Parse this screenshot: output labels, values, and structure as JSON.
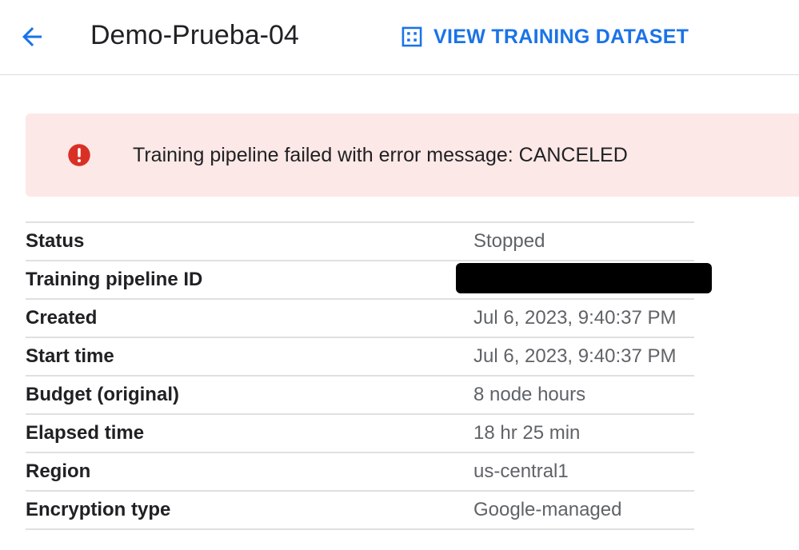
{
  "header": {
    "back_icon": "arrow-left-icon",
    "title": "Demo-Prueba-04",
    "view_dataset": {
      "icon": "dataset-grid-icon",
      "label": "VIEW TRAINING DATASET"
    }
  },
  "error_banner": {
    "icon": "error-icon",
    "message": "Training pipeline failed with error message: CANCELED"
  },
  "details": [
    {
      "label": "Status",
      "value": "Stopped"
    },
    {
      "label": "Training pipeline ID",
      "value": "",
      "redacted": true
    },
    {
      "label": "Created",
      "value": "Jul 6, 2023, 9:40:37 PM"
    },
    {
      "label": "Start time",
      "value": "Jul 6, 2023, 9:40:37 PM"
    },
    {
      "label": "Budget (original)",
      "value": "8 node hours"
    },
    {
      "label": "Elapsed time",
      "value": "18 hr 25 min"
    },
    {
      "label": "Region",
      "value": "us-central1"
    },
    {
      "label": "Encryption type",
      "value": "Google-managed"
    }
  ],
  "colors": {
    "accent": "#1a73e8",
    "error_bg": "#fce8e6",
    "error_icon": "#d93025",
    "value_text": "#5f6368",
    "redaction": "#000000"
  }
}
